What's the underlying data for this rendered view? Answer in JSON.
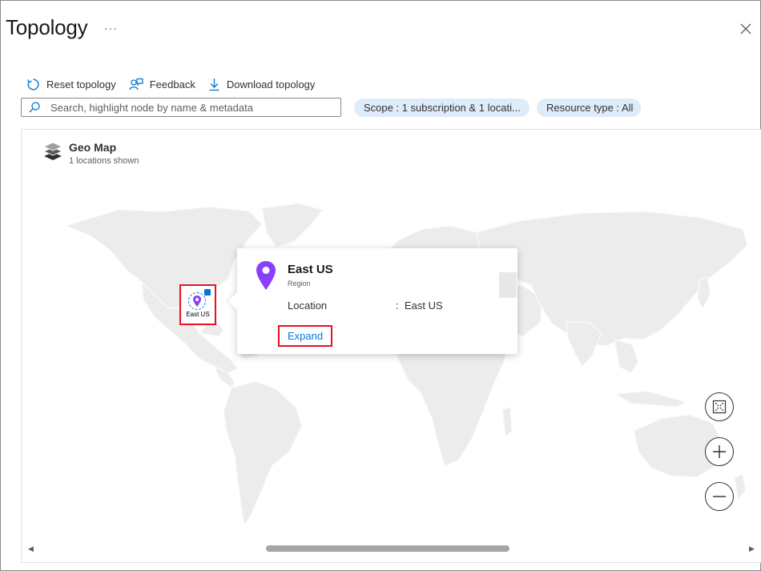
{
  "blade": {
    "title": "Topology",
    "more_label": "···"
  },
  "toolbar": {
    "reset_label": "Reset topology",
    "feedback_label": "Feedback",
    "download_label": "Download topology"
  },
  "search": {
    "placeholder": "Search, highlight node by name & metadata",
    "value": ""
  },
  "filters": {
    "scope_label": "Scope : 1 subscription & 1 locati...",
    "resource_type_label": "Resource type : All"
  },
  "geo_map": {
    "title": "Geo Map",
    "subtitle": "1 locations shown"
  },
  "node": {
    "label": "East US",
    "icon": "location-pin-icon"
  },
  "callout": {
    "title": "East US",
    "subtitle": "Region",
    "property_key": "Location",
    "property_separator": ":",
    "property_value": "East US",
    "expand_label": "Expand"
  },
  "zoom": {
    "fit_icon": "fit-to-screen-icon",
    "in_icon": "zoom-in-icon",
    "out_icon": "zoom-out-icon"
  },
  "colors": {
    "accent": "#0078d4",
    "highlight": "#e81123",
    "pill_bg": "#deecf9",
    "pin": "#8a3ffc",
    "land": "#ececec"
  }
}
